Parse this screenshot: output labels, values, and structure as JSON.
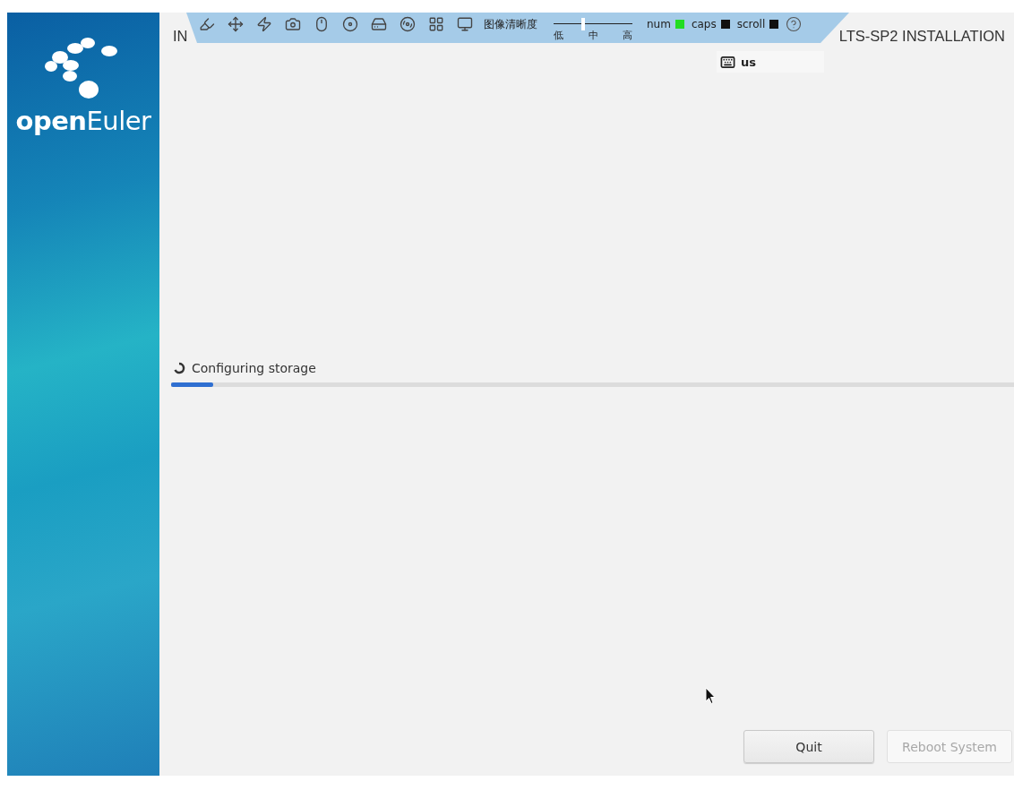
{
  "sidebar": {
    "logo_text": "**open**Euler"
  },
  "header": {
    "title_left": "IN",
    "title_right": "LTS-SP2 INSTALLATION",
    "keyboard_layout": "us"
  },
  "toolbar": {
    "quality_label": "图像清晰度",
    "quality_slider": {
      "level": 0.38,
      "ticks": [
        "低",
        "中",
        "高"
      ]
    },
    "lock_keys": [
      {
        "label": "num",
        "on": true
      },
      {
        "label": "caps",
        "on": false
      },
      {
        "label": "scroll",
        "on": false
      }
    ]
  },
  "progress": {
    "status": "Configuring storage",
    "level": 0.05
  },
  "buttons": [
    {
      "label": "Quit",
      "disabled": false
    },
    {
      "label": "Reboot System",
      "disabled": true
    }
  ]
}
